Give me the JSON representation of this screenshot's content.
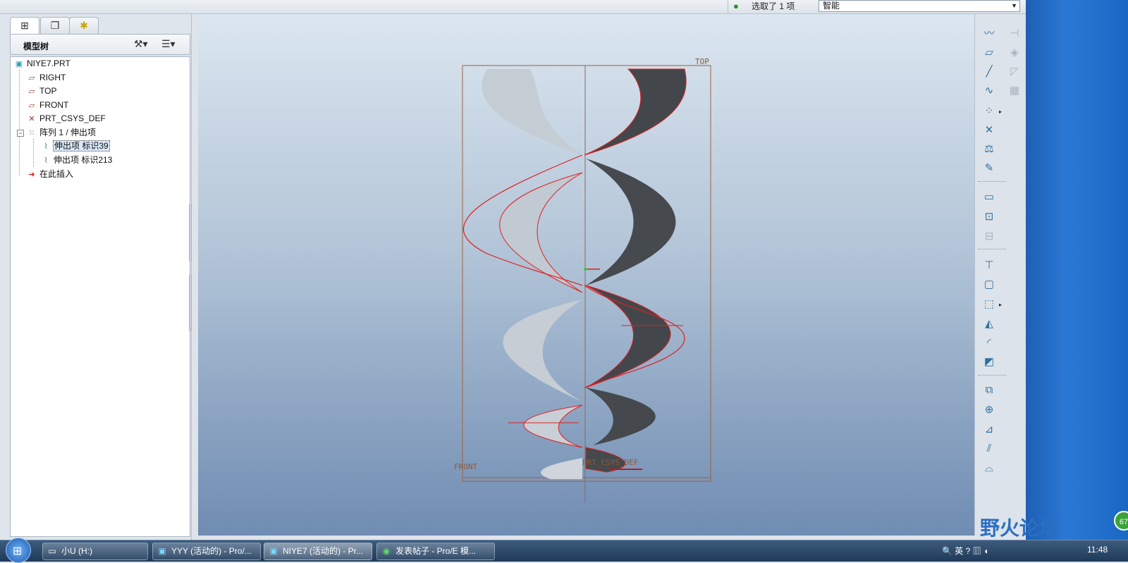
{
  "status": {
    "selection_text": "选取了 1 项",
    "filter_value": "智能"
  },
  "left_panel": {
    "tabs": [
      {
        "icon": "model-tree-icon"
      },
      {
        "icon": "layers-icon"
      },
      {
        "icon": "favorites-icon"
      }
    ],
    "tree_title": "模型树",
    "items": [
      {
        "label": "NIYE7.PRT",
        "icon": "part-icon"
      },
      {
        "label": "RIGHT",
        "icon": "datum-plane-icon"
      },
      {
        "label": "TOP",
        "icon": "datum-plane-icon"
      },
      {
        "label": "FRONT",
        "icon": "datum-plane-icon"
      },
      {
        "label": "PRT_CSYS_DEF",
        "icon": "csys-icon"
      },
      {
        "label": "阵列 1 / 伸出项",
        "icon": "pattern-icon"
      },
      {
        "label": "伸出项 标识39",
        "icon": "protrusion-icon"
      },
      {
        "label": "伸出项 标识213",
        "icon": "protrusion-icon"
      },
      {
        "label": "在此插入",
        "icon": "insert-here-icon"
      }
    ]
  },
  "viewport": {
    "datum_labels": {
      "top": "TOP",
      "front": "FRONT",
      "csys": "PRT_CSYS_DEF"
    }
  },
  "taskbar": {
    "items": [
      {
        "label": "小U (H:)"
      },
      {
        "label": "YYY (活动的) - Pro/..."
      },
      {
        "label": "NIYE7 (活动的) - Pr..."
      },
      {
        "label": "发表帖子 - Pro/E 模..."
      }
    ],
    "tray_text": "英",
    "clock": "11:48"
  },
  "watermark": "野火论坛",
  "badge": "67"
}
